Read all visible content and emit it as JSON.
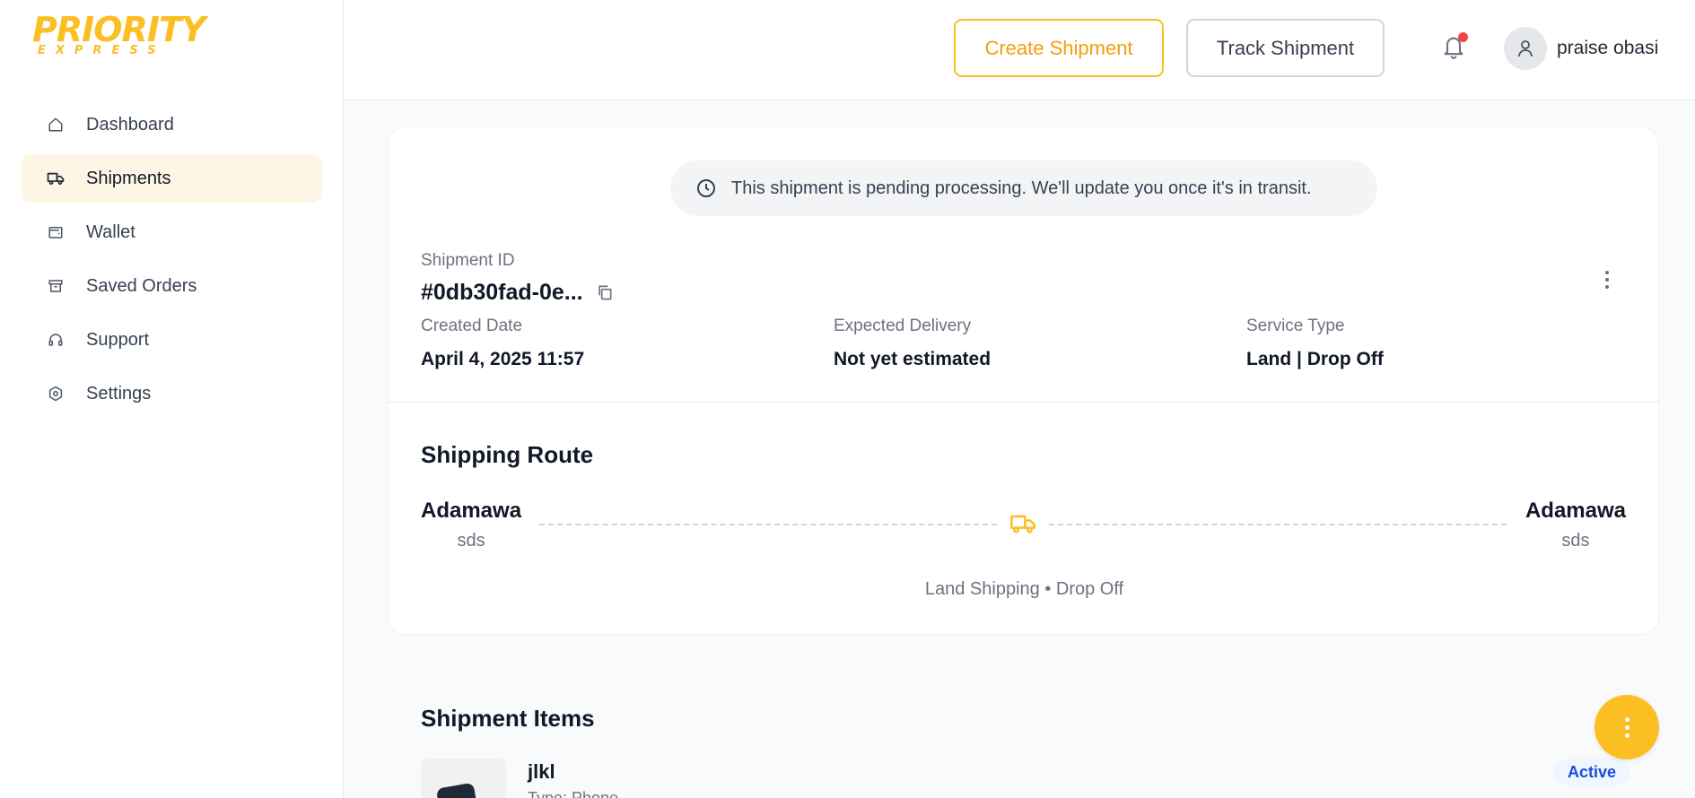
{
  "logo": {
    "brand": "PRIORITY",
    "sub": "EXPRESS"
  },
  "sidebar": {
    "items": [
      {
        "label": "Dashboard",
        "icon": "home-icon",
        "active": false
      },
      {
        "label": "Shipments",
        "icon": "truck-icon",
        "active": true
      },
      {
        "label": "Wallet",
        "icon": "wallet-icon",
        "active": false
      },
      {
        "label": "Saved Orders",
        "icon": "archive-icon",
        "active": false
      },
      {
        "label": "Support",
        "icon": "headset-icon",
        "active": false
      },
      {
        "label": "Settings",
        "icon": "settings-icon",
        "active": false
      }
    ]
  },
  "header": {
    "create_label": "Create Shipment",
    "track_label": "Track Shipment",
    "user_name": "praise obasi",
    "has_notification": true
  },
  "notice": {
    "text": "This shipment is pending processing. We'll update you once it's in transit."
  },
  "shipment": {
    "id_label": "Shipment ID",
    "id_value": "#0db30fad-0e...",
    "created_label": "Created Date",
    "created_value": "April 4, 2025 11:57",
    "expected_label": "Expected Delivery",
    "expected_value": "Not yet estimated",
    "service_label": "Service Type",
    "service_value": "Land | Drop Off"
  },
  "route": {
    "title": "Shipping Route",
    "from_city": "Adamawa",
    "from_sub": "sds",
    "to_city": "Adamawa",
    "to_sub": "sds",
    "caption": "Land Shipping • Drop Off"
  },
  "items": {
    "title": "Shipment Items",
    "list": [
      {
        "name": "jlkl",
        "type": "Type: Phone",
        "status": "Active"
      }
    ]
  },
  "colors": {
    "accent": "#fbbf24",
    "active_bg": "#fef6e4",
    "notification": "#ef4444",
    "badge_text": "#1d4ed8"
  }
}
